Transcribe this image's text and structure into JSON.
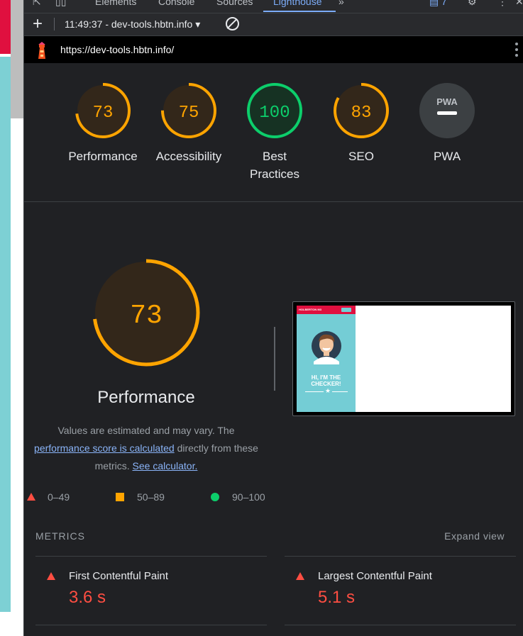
{
  "devtools": {
    "tabs": [
      "Elements",
      "Console",
      "Sources",
      "Lighthouse"
    ],
    "active_tab": "Lighthouse",
    "issues_count": "7"
  },
  "toolbar": {
    "report_label": "11:49:37 - dev-tools.hbtn.info"
  },
  "urlbar": {
    "url": "https://dev-tools.hbtn.info/"
  },
  "gauges": [
    {
      "label": "Performance",
      "score": "73",
      "fraction": 0.73,
      "color": "#ffa400"
    },
    {
      "label": "Accessibility",
      "score": "75",
      "fraction": 0.75,
      "color": "#ffa400"
    },
    {
      "label_line1": "Best",
      "label_line2": "Practices",
      "score": "100",
      "fraction": 1.0,
      "color": "#0cce6b"
    },
    {
      "label": "SEO",
      "score": "83",
      "fraction": 0.83,
      "color": "#ffa400"
    },
    {
      "label": "PWA",
      "badge": "PWA",
      "color": "#9aa0a6"
    }
  ],
  "performance": {
    "score": "73",
    "fraction": 0.73,
    "title": "Performance",
    "desc_line1": "Values are estimated and may vary. The",
    "desc_link1": "performance score is calculated",
    "desc_mid": " directly from these",
    "desc_line3": "metrics.",
    "desc_link2": "See calculator."
  },
  "screenshot": {
    "brand": "HOLBERTON M3",
    "title_line1": "HI, I'M THE",
    "title_line2": "CHECKER!"
  },
  "legend": [
    {
      "range": "0–49",
      "color": "#ff4e42"
    },
    {
      "range": "50–89",
      "color": "#ffa400"
    },
    {
      "range": "90–100",
      "color": "#0cce6b"
    }
  ],
  "metrics": {
    "heading": "METRICS",
    "expand_label": "Expand view",
    "items": [
      {
        "name": "First Contentful Paint",
        "value": "3.6 s"
      },
      {
        "name": "Largest Contentful Paint",
        "value": "5.1 s"
      }
    ]
  }
}
